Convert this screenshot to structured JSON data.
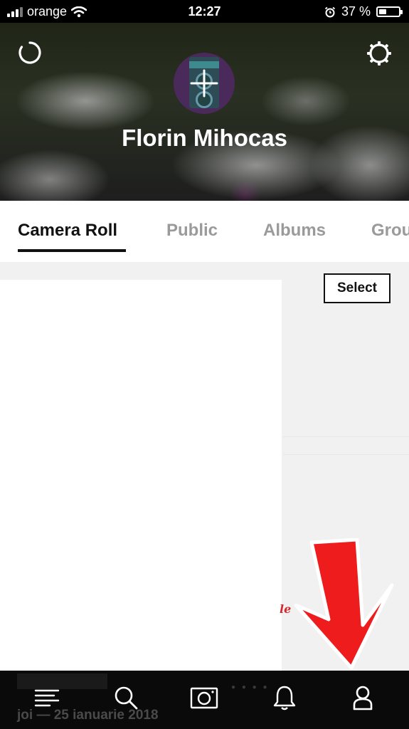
{
  "status_bar": {
    "carrier": "orange",
    "time": "12:27",
    "battery_text": "37 %",
    "battery_level": 0.37,
    "icons": [
      "signal-icon",
      "wifi-icon",
      "alarm-icon",
      "battery-icon"
    ]
  },
  "header": {
    "profile_name": "Florin Mihocas",
    "icons": [
      "refresh-icon",
      "settings-icon",
      "add-avatar-icon"
    ]
  },
  "tabs": [
    {
      "label": "Camera Roll",
      "active": true
    },
    {
      "label": "Public",
      "active": false
    },
    {
      "label": "Albums",
      "active": false
    },
    {
      "label": "Grou",
      "active": false
    }
  ],
  "content": {
    "select_label": "Select",
    "overlay_script": "le"
  },
  "bottom_nav": {
    "items": [
      "feed-icon",
      "search-icon",
      "camera-icon",
      "notifications-icon",
      "profile-icon"
    ],
    "underlying_date": "joi — 25 ianuarie 2018"
  },
  "colors": {
    "accent_arrow": "#ee1c1c",
    "tab_active": "#111111",
    "tab_inactive": "#9a9a9a",
    "nav_background": "#0a0a0a"
  }
}
